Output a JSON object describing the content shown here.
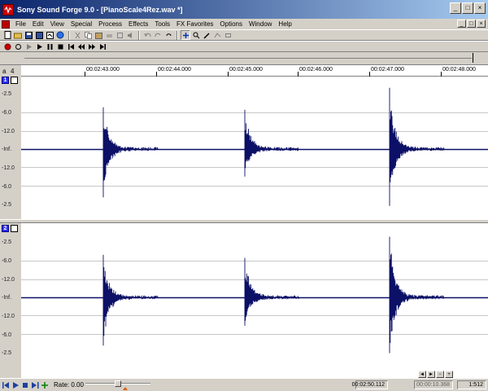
{
  "window": {
    "title": "Sony Sound Forge 9.0 - [PianoScale4Rez.wav *]",
    "buttons": [
      "_",
      "□",
      "×"
    ],
    "mdi_buttons": [
      "_",
      "□",
      "×"
    ]
  },
  "menu": {
    "items": [
      "File",
      "Edit",
      "View",
      "Special",
      "Process",
      "Effects",
      "Tools",
      "FX Favorites",
      "Options",
      "Window",
      "Help"
    ]
  },
  "ruler": {
    "labels": [
      "00:02:43.000",
      "00:02:44.000",
      "00:02:45.000",
      "00:02:46.000",
      "00:02:47.000",
      "00:02:48.000"
    ]
  },
  "channels": [
    {
      "number": "1",
      "db_labels": [
        "-2.5",
        "-6.0",
        "-12.0",
        "-Inf.",
        "-12.0",
        "-6.0",
        "-2.5"
      ]
    },
    {
      "number": "2",
      "db_labels": [
        "-2.5",
        "-6.0",
        "-12.0",
        "-Inf.",
        "-12.0",
        "-6.0",
        "-2.5"
      ]
    }
  ],
  "status": {
    "rate_label": "Rate: 0.00",
    "time_position": "00:02:50.112",
    "time_length": "00:00:10.368",
    "zoom": "1:512"
  },
  "colors": {
    "waveform": "#0c1066",
    "record": "#cc0000",
    "channel_button": "#3030ff"
  }
}
